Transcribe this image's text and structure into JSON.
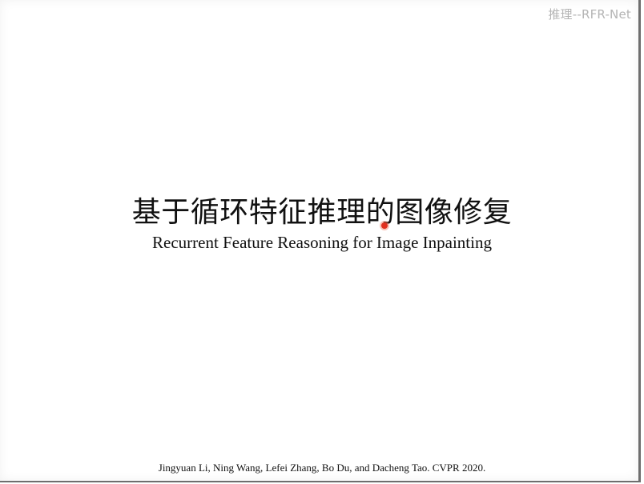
{
  "watermark": "推理--RFR-Net",
  "slide": {
    "title_zh": "基于循环特征推理的图像修复",
    "title_en": "Recurrent Feature Reasoning for Image Inpainting",
    "citation": "Jingyuan Li, Ning Wang, Lefei Zhang, Bo Du, and Dacheng Tao. CVPR 2020."
  },
  "pointer": {
    "color": "#e0301e"
  }
}
